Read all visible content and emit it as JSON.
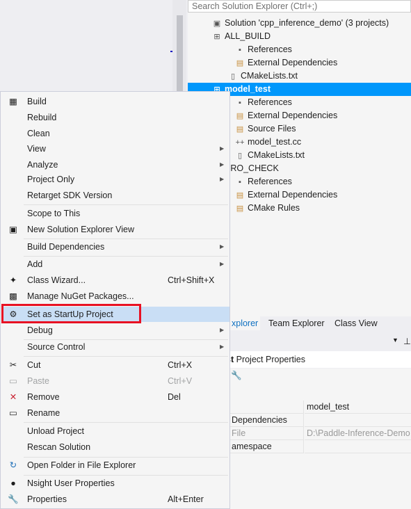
{
  "solution_explorer": {
    "search_placeholder": "Search Solution Explorer (Ctrl+;)",
    "tree": [
      {
        "label": "Solution 'cpp_inference_demo' (3 projects)",
        "icon": "solution-icon"
      },
      {
        "label": "ALL_BUILD",
        "icon": "project-icon"
      },
      {
        "label": "References",
        "icon": "references-icon"
      },
      {
        "label": "External Dependencies",
        "icon": "folder-icon"
      },
      {
        "label": "CMakeLists.txt",
        "icon": "file-icon"
      },
      {
        "label": "model_test",
        "icon": "project-icon",
        "selected": true
      },
      {
        "label": "References",
        "icon": "references-icon"
      },
      {
        "label": "External Dependencies",
        "icon": "folder-icon"
      },
      {
        "label": "Source Files",
        "icon": "folder-icon"
      },
      {
        "label": "model_test.cc",
        "icon": "cpp-file-icon"
      },
      {
        "label": "CMakeLists.txt",
        "icon": "file-icon"
      },
      {
        "label": "ERO_CHECK",
        "icon": "project-icon"
      },
      {
        "label": "References",
        "icon": "references-icon"
      },
      {
        "label": "External Dependencies",
        "icon": "folder-icon"
      },
      {
        "label": "CMake Rules",
        "icon": "folder-icon"
      }
    ],
    "tabs": [
      "xplorer",
      "Team Explorer",
      "Class View"
    ]
  },
  "properties": {
    "header_bold": "st",
    "header": "Project Properties",
    "rows": [
      [
        "",
        "model_test"
      ],
      [
        "Dependencies",
        ""
      ],
      [
        "File",
        "D:\\Paddle-Inference-Demo"
      ],
      [
        "amespace",
        ""
      ]
    ]
  },
  "menu": {
    "items": [
      {
        "label": "Build",
        "icon": "build-icon"
      },
      {
        "label": "Rebuild"
      },
      {
        "label": "Clean"
      },
      {
        "label": "View",
        "submenu": true
      },
      {
        "label": "Analyze",
        "submenu": true
      },
      {
        "label": "Project Only",
        "submenu": true
      },
      {
        "label": "Retarget SDK Version"
      },
      {
        "label": "Scope to This"
      },
      {
        "label": "New Solution Explorer View",
        "icon": "new-view-icon"
      },
      {
        "label": "Build Dependencies",
        "submenu": true
      },
      {
        "label": "Add",
        "submenu": true
      },
      {
        "label": "Class Wizard...",
        "shortcut": "Ctrl+Shift+X",
        "icon": "class-wizard-icon"
      },
      {
        "label": "Manage NuGet Packages...",
        "icon": "nuget-icon"
      },
      {
        "label": "Set as StartUp Project",
        "icon": "gear-icon",
        "highlighted": true
      },
      {
        "label": "Debug",
        "submenu": true
      },
      {
        "label": "Source Control",
        "submenu": true
      },
      {
        "label": "Cut",
        "shortcut": "Ctrl+X",
        "icon": "scissors-icon"
      },
      {
        "label": "Paste",
        "shortcut": "Ctrl+V",
        "icon": "paste-icon",
        "disabled": true
      },
      {
        "label": "Remove",
        "shortcut": "Del",
        "icon": "remove-icon"
      },
      {
        "label": "Rename",
        "icon": "rename-icon"
      },
      {
        "label": "Unload Project"
      },
      {
        "label": "Rescan Solution"
      },
      {
        "label": "Open Folder in File Explorer",
        "icon": "refresh-folder-icon"
      },
      {
        "label": "Nsight User Properties",
        "icon": "nsight-icon"
      },
      {
        "label": "Properties",
        "shortcut": "Alt+Enter",
        "icon": "wrench-icon"
      }
    ]
  },
  "colors": {
    "selection": "#0097fb",
    "menu_highlight": "#c9def5",
    "callout": "#e81123"
  }
}
